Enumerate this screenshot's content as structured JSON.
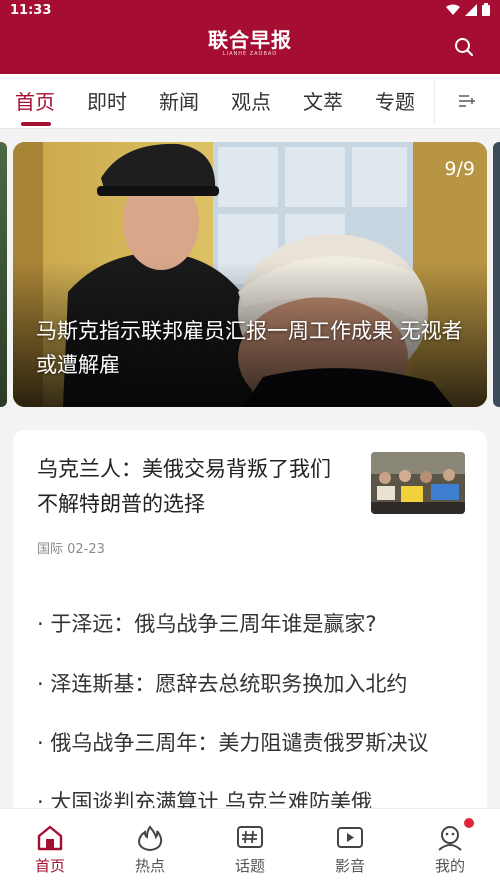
{
  "status_bar": {
    "time": "11:33"
  },
  "header": {
    "logo": "联合早报",
    "logo_sub": "LIANHE ZAOBAO"
  },
  "tabs": [
    {
      "label": "首页",
      "active": true
    },
    {
      "label": "即时"
    },
    {
      "label": "新闻"
    },
    {
      "label": "观点"
    },
    {
      "label": "文萃"
    },
    {
      "label": "专题"
    }
  ],
  "carousel": {
    "counter": "9/9",
    "title": "马斯克指示联邦雇员汇报一周工作成果 无视者或遭解雇"
  },
  "lead_article": {
    "title": "乌克兰人：美俄交易背叛了我们 不解特朗普的选择",
    "meta": "国际 02-23"
  },
  "related": [
    "· 于泽远：俄乌战争三周年谁是赢家?",
    "· 泽连斯基：愿辞去总统职务换加入北约",
    "· 俄乌战争三周年：美力阻谴责俄罗斯决议",
    "· 大国谈判充满算计 乌克兰难防美俄"
  ],
  "bottom_nav": [
    {
      "label": "首页",
      "icon": "home-icon",
      "active": true
    },
    {
      "label": "热点",
      "icon": "flame-icon"
    },
    {
      "label": "话题",
      "icon": "hashtag-icon"
    },
    {
      "label": "影音",
      "icon": "play-icon"
    },
    {
      "label": "我的",
      "icon": "profile-icon"
    }
  ],
  "colors": {
    "brand": "#a50e32",
    "badge": "#e0263b"
  }
}
